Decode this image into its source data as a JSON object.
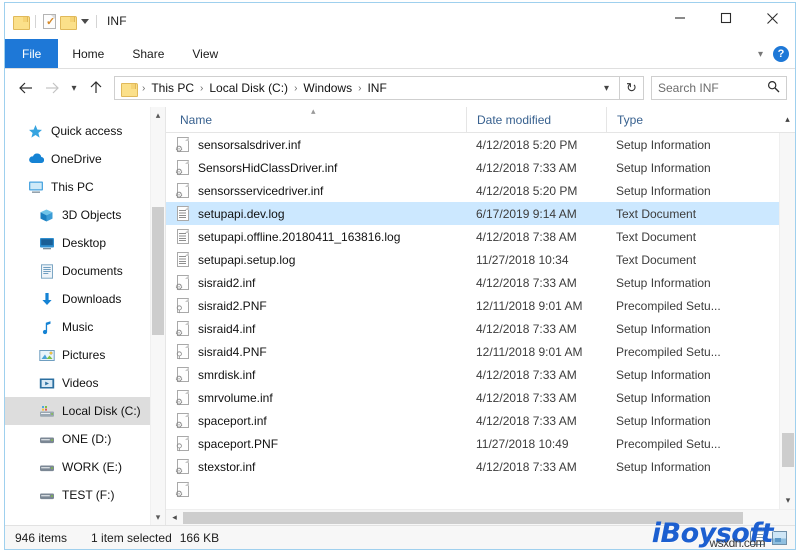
{
  "window": {
    "title": "INF",
    "quick_access": [
      {
        "name": "folder-icon",
        "label": ""
      },
      {
        "name": "properties-icon",
        "label": ""
      },
      {
        "name": "new-folder-icon",
        "label": ""
      },
      {
        "name": "customize-caret-icon",
        "label": ""
      }
    ],
    "controls": {
      "minimize": "minimize-icon",
      "maximize": "maximize-icon",
      "close": "close-icon"
    }
  },
  "ribbon": {
    "tabs": [
      {
        "label": "File",
        "active": true
      },
      {
        "label": "Home",
        "active": false
      },
      {
        "label": "Share",
        "active": false
      },
      {
        "label": "View",
        "active": false
      }
    ],
    "collapse_icon": "chevron-down-icon",
    "help_label": "?"
  },
  "address": {
    "back_icon": "arrow-left-icon",
    "forward_icon": "arrow-right-icon",
    "recent_icon": "chevron-down-icon",
    "up_icon": "arrow-up-icon",
    "crumbs": [
      "This PC",
      "Local Disk (C:)",
      "Windows",
      "INF"
    ],
    "separator": "›",
    "dropdown_icon": "chevron-down-icon",
    "refresh_icon": "↻",
    "search_placeholder": "Search INF",
    "search_value": "",
    "search_icon": "search-icon"
  },
  "sidebar": {
    "items": [
      {
        "label": "Quick access",
        "icon": "star-icon",
        "indent": false,
        "selected": false
      },
      {
        "label": "OneDrive",
        "icon": "cloud-icon",
        "indent": false,
        "selected": false
      },
      {
        "label": "This PC",
        "icon": "monitor-icon",
        "indent": false,
        "selected": false
      },
      {
        "label": "3D Objects",
        "icon": "cube-icon",
        "indent": true,
        "selected": false
      },
      {
        "label": "Desktop",
        "icon": "desktop-icon",
        "indent": true,
        "selected": false
      },
      {
        "label": "Documents",
        "icon": "documents-icon",
        "indent": true,
        "selected": false
      },
      {
        "label": "Downloads",
        "icon": "download-arrow-icon",
        "indent": true,
        "selected": false
      },
      {
        "label": "Music",
        "icon": "music-note-icon",
        "indent": true,
        "selected": false
      },
      {
        "label": "Pictures",
        "icon": "pictures-icon",
        "indent": true,
        "selected": false
      },
      {
        "label": "Videos",
        "icon": "videos-icon",
        "indent": true,
        "selected": false
      },
      {
        "label": "Local Disk (C:)",
        "icon": "local-disk-icon",
        "indent": true,
        "selected": true
      },
      {
        "label": "ONE (D:)",
        "icon": "drive-icon",
        "indent": true,
        "selected": false
      },
      {
        "label": "WORK (E:)",
        "icon": "drive-icon",
        "indent": true,
        "selected": false
      },
      {
        "label": "TEST (F:)",
        "icon": "drive-icon",
        "indent": true,
        "selected": false
      }
    ],
    "scroll_up_icon": "chevron-up-icon",
    "scroll_down_icon": "chevron-down-icon"
  },
  "filelist": {
    "columns": [
      {
        "label": "Name",
        "sort": "asc"
      },
      {
        "label": "Date modified",
        "sort": ""
      },
      {
        "label": "Type",
        "sort": ""
      }
    ],
    "rows": [
      {
        "name": "sensorsalsdriver.inf",
        "date": "4/12/2018 5:20 PM",
        "type": "Setup Information",
        "icon": "inf-file-icon",
        "selected": false
      },
      {
        "name": "SensorsHidClassDriver.inf",
        "date": "4/12/2018 7:33 AM",
        "type": "Setup Information",
        "icon": "inf-file-icon",
        "selected": false
      },
      {
        "name": "sensorsservicedriver.inf",
        "date": "4/12/2018 5:20 PM",
        "type": "Setup Information",
        "icon": "inf-file-icon",
        "selected": false
      },
      {
        "name": "setupapi.dev.log",
        "date": "6/17/2019 9:14 AM",
        "type": "Text Document",
        "icon": "text-file-icon",
        "selected": true
      },
      {
        "name": "setupapi.offline.20180411_163816.log",
        "date": "4/12/2018 7:38 AM",
        "type": "Text Document",
        "icon": "text-file-icon",
        "selected": false
      },
      {
        "name": "setupapi.setup.log",
        "date": "11/27/2018 10:34",
        "type": "Text Document",
        "icon": "text-file-icon",
        "selected": false
      },
      {
        "name": "sisraid2.inf",
        "date": "4/12/2018 7:33 AM",
        "type": "Setup Information",
        "icon": "inf-file-icon",
        "selected": false
      },
      {
        "name": "sisraid2.PNF",
        "date": "12/11/2018 9:01 AM",
        "type": "Precompiled Setu...",
        "icon": "pnf-file-icon",
        "selected": false
      },
      {
        "name": "sisraid4.inf",
        "date": "4/12/2018 7:33 AM",
        "type": "Setup Information",
        "icon": "inf-file-icon",
        "selected": false
      },
      {
        "name": "sisraid4.PNF",
        "date": "12/11/2018 9:01 AM",
        "type": "Precompiled Setu...",
        "icon": "pnf-file-icon",
        "selected": false
      },
      {
        "name": "smrdisk.inf",
        "date": "4/12/2018 7:33 AM",
        "type": "Setup Information",
        "icon": "inf-file-icon",
        "selected": false
      },
      {
        "name": "smrvolume.inf",
        "date": "4/12/2018 7:33 AM",
        "type": "Setup Information",
        "icon": "inf-file-icon",
        "selected": false
      },
      {
        "name": "spaceport.inf",
        "date": "4/12/2018 7:33 AM",
        "type": "Setup Information",
        "icon": "inf-file-icon",
        "selected": false
      },
      {
        "name": "spaceport.PNF",
        "date": "11/27/2018 10:49",
        "type": "Precompiled Setu...",
        "icon": "pnf-file-icon",
        "selected": false
      },
      {
        "name": "stexstor.inf",
        "date": "4/12/2018 7:33 AM",
        "type": "Setup Information",
        "icon": "inf-file-icon",
        "selected": false
      }
    ]
  },
  "statusbar": {
    "item_count": "946 items",
    "selection": "1 item selected",
    "size": "166 KB",
    "view_details_icon": "details-view-icon",
    "view_thumbs_icon": "large-icons-view-icon"
  },
  "watermark": {
    "brand": "iBoysoft",
    "site": "wsxdn.com"
  },
  "colors": {
    "accent": "#1e78d7",
    "selection": "#cce8ff",
    "sidebar_selection": "#dddddd",
    "header_text": "#38618f"
  }
}
